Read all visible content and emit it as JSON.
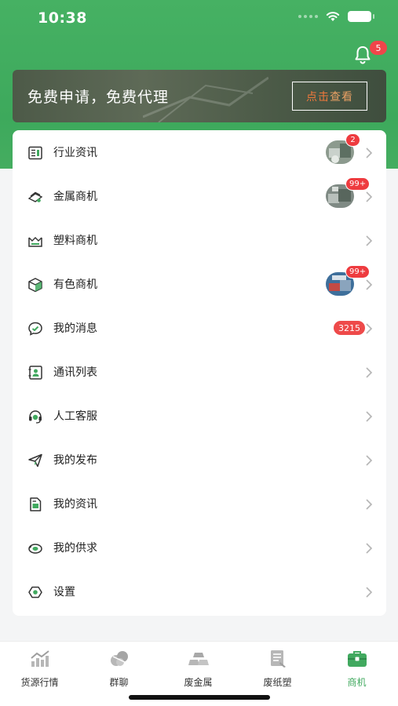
{
  "status_bar": {
    "time": "10:38"
  },
  "header": {
    "notification_count": "5"
  },
  "banner": {
    "text": "免费申请，免费代理",
    "button_part1": "点击",
    "button_part2": "查看"
  },
  "menu": [
    {
      "label": "行业资讯",
      "icon": "news-icon",
      "thumb_badge": "2"
    },
    {
      "label": "金属商机",
      "icon": "metal-icon",
      "thumb_badge": "99+"
    },
    {
      "label": "塑料商机",
      "icon": "plastic-icon"
    },
    {
      "label": "有色商机",
      "icon": "box-icon",
      "thumb_badge": "99+"
    },
    {
      "label": "我的消息",
      "icon": "message-icon",
      "count_badge": "3215"
    },
    {
      "label": "通讯列表",
      "icon": "contacts-icon"
    },
    {
      "label": "人工客服",
      "icon": "headset-icon"
    },
    {
      "label": "我的发布",
      "icon": "send-icon"
    },
    {
      "label": "我的资讯",
      "icon": "document-icon"
    },
    {
      "label": "我的供求",
      "icon": "supply-icon"
    },
    {
      "label": "设置",
      "icon": "settings-icon"
    }
  ],
  "tabbar": [
    {
      "label": "货源行情",
      "icon": "chart-icon"
    },
    {
      "label": "群聊",
      "icon": "group-chat-icon"
    },
    {
      "label": "废金属",
      "icon": "metal-bars-icon"
    },
    {
      "label": "废纸塑",
      "icon": "paper-icon"
    },
    {
      "label": "商机",
      "icon": "briefcase-icon",
      "active": true
    }
  ],
  "colors": {
    "primary": "#41a95f",
    "badge": "#ee3b3f"
  }
}
